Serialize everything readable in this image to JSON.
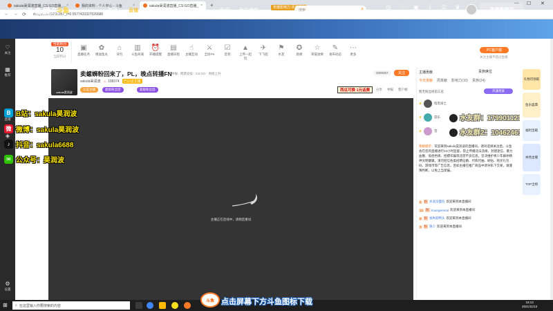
{
  "browser": {
    "tabs": [
      {
        "title": "sakula昊润波直播_CS:GO直播_…",
        "active": false
      },
      {
        "title": "我的资料 - 个人中心 - 斗鱼",
        "active": false
      },
      {
        "title": "sakula昊润波直播_CS:GO直播_",
        "active": true
      }
    ],
    "url": "douyu.com/3089357_r=0.5577433327026686",
    "new_tab": "+",
    "back": "←",
    "forward": "→",
    "reload": "⟳",
    "win_min": "—",
    "win_max": "☐",
    "win_close": "✕"
  },
  "header": {
    "logo": "斗鱼娱乐",
    "logo_badge": "斗鱼",
    "nav": [
      "首页",
      "直播",
      "分类",
      "视频",
      "游戏",
      "鱼吧",
      "鱼乐盛典"
    ],
    "nav_active": "直播",
    "promo": "年度影响力 评选盛典",
    "search_placeholder": "搜索",
    "icons": [
      {
        "icon": "history-icon",
        "label": "历史"
      },
      {
        "icon": "follow-icon",
        "label": "关注"
      },
      {
        "icon": "broadcast-icon",
        "label": "开播"
      },
      {
        "icon": "noble-icon",
        "label": "客户端"
      },
      {
        "icon": "task-icon",
        "label": "任务"
      },
      {
        "icon": "chat-icon",
        "label": "会员"
      }
    ],
    "banner": "年度影响力"
  },
  "left_sidebar": [
    {
      "icon": "heart-icon",
      "label": "关注"
    },
    {
      "icon": "grid-icon",
      "label": "推荐"
    },
    {
      "icon": "tv-icon",
      "label": "直播"
    },
    {
      "icon": "game-icon",
      "label": "游戏"
    },
    {
      "icon": "gear-icon",
      "label": "设置"
    }
  ],
  "overlay_social": [
    {
      "icon": "bilibili-icon",
      "text": "B站：sakula昊润波",
      "color": "#00a1d6",
      "glyph": "B"
    },
    {
      "icon": "weibo-icon",
      "text": "微博：sakula昊润波",
      "color": "#e6162d",
      "glyph": "微"
    },
    {
      "icon": "douyin-icon",
      "text": "抖音：sakula6688",
      "color": "#111111",
      "glyph": "♪"
    },
    {
      "icon": "wechat-icon",
      "text": "公众号：昊润波",
      "color": "#2dc100",
      "glyph": "✉"
    }
  ],
  "level": {
    "badge": "当前积分",
    "number": "10",
    "caption": "当前积分"
  },
  "functions": [
    {
      "icon": "task-icon",
      "label": "直播任务"
    },
    {
      "icon": "gift-icon",
      "label": "赠送鱼丸"
    },
    {
      "icon": "bag-icon",
      "label": "背包"
    },
    {
      "icon": "shop-icon",
      "label": "斗鱼商城"
    },
    {
      "icon": "alarm-icon",
      "label": "开播提醒"
    },
    {
      "icon": "calendar-icon",
      "label": "直播日程"
    },
    {
      "icon": "hand-icon",
      "label": "主播互动"
    },
    {
      "icon": "pk-icon",
      "label": "全民PK"
    },
    {
      "icon": "checklist-icon",
      "label": "签到"
    },
    {
      "icon": "chart-icon",
      "label": "上传一起玩"
    },
    {
      "icon": "cart-icon",
      "label": "下飞船"
    },
    {
      "icon": "flag-icon",
      "label": "水友"
    },
    {
      "icon": "medal-icon",
      "label": "勋章"
    },
    {
      "icon": "star-icon",
      "label": "荣誉勋章"
    },
    {
      "icon": "edit-icon",
      "label": "发布动态"
    },
    {
      "icon": "more-icon",
      "label": "更多"
    }
  ],
  "pc_client": {
    "label": "PC客户端",
    "caption": "关注主播不错过直播"
  },
  "room": {
    "title": "卖螺蛳粉回来了，PL，晚点转播FN",
    "category": "举报 · 网游竞技 · CS:GO · 周榜上升",
    "streamer": "sakula昊润波",
    "fans": "108374",
    "level_tag": "已认证主播",
    "rid": "3089357",
    "follow": "关注",
    "tags": [
      "认证主播",
      "超级粉丝团",
      "超级粉丝团"
    ],
    "red_tag": "西瓜可换 1元话费",
    "actions": [
      "分享",
      "举报",
      "客户端"
    ]
  },
  "video": {
    "message": "主播正在连线中，请稍后重试"
  },
  "right_panel": {
    "rank_header": "主播贡献",
    "noble_slot": "贵族席位",
    "tabs": [
      "今日贡献",
      "周贡献",
      "影响力(10)",
      "贵族(24)"
    ],
    "tab_active": "今日贡献",
    "notify": "暂无粉丝榜前三名",
    "dianyu_btn": "开通贵族",
    "ranks": [
      {
        "label": "2楼",
        "name": "暗黑骑士"
      },
      {
        "label": "1楼",
        "name": "游乐"
      },
      {
        "label": "2楼",
        "name": "雪"
      }
    ],
    "qq_lines": [
      "水友群：1799011211",
      "水友群2：1046246186"
    ],
    "system_label": "系统提示：",
    "system_note": "欢迎来到sakula昊润波的直播间，请对选择关注后，斗鱼会在您的直播进行24小时监督，禁止传播违法违规、封建迷信、暴力血腥、低俗色情、招嫖诈骗等违禁不良信息，坚决维护青少年群体精神文明健康。请勿轻信各类招聘征婚、代练代抽、刷钻、购买礼包码、游戏币等广告信息，且如主播在推广商品中诱导私下交易，请谨慎判断，以免上当受骗。",
    "chats": [
      {
        "level": "5",
        "badge": "粉",
        "name": "水泥没面包",
        "text": "欢迎来到本直播间"
      },
      {
        "level": "12",
        "badge": "粉",
        "name": "Kuangeneral",
        "text": "欢迎来到本直播间"
      },
      {
        "level": "9",
        "badge": "粉",
        "name": "张失踪鸭头",
        "text": "欢迎来到本直播间"
      },
      {
        "level": "3",
        "badge": "粉",
        "name": "隐少",
        "text": "欢迎来到本直播间"
      }
    ]
  },
  "right_cards": [
    "礼物可领取",
    "鱼乐盛典",
    "福利宝箱",
    "本场主播",
    "TOP全榜"
  ],
  "subtitle": {
    "logo": "斗鱼",
    "text": "点击屏幕下方斗鱼图标下载"
  },
  "taskbar": {
    "start": "⊞",
    "search": "在这里输入你要搜索的内容",
    "time": "16:13",
    "date": "2021/11/13"
  }
}
